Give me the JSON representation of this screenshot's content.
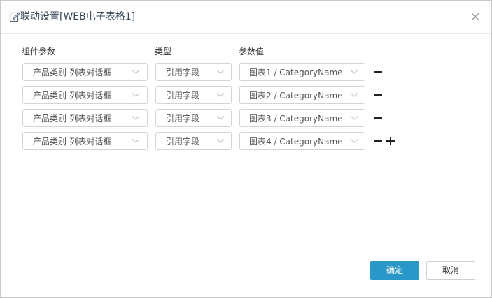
{
  "dialog": {
    "title": "联动设置[WEB电子表格1]",
    "close_icon": "close-icon",
    "edit_icon": "edit-icon"
  },
  "headers": {
    "component_param": "组件参数",
    "type": "类型",
    "param_value": "参数值"
  },
  "rows": [
    {
      "component": "产品类别-列表对话框",
      "type": "引用字段",
      "value": "图表1 / CategoryName"
    },
    {
      "component": "产品类别-列表对话框",
      "type": "引用字段",
      "value": "图表2 / CategoryName"
    },
    {
      "component": "产品类别-列表对话框",
      "type": "引用字段",
      "value": "图表3 / CategoryName"
    },
    {
      "component": "产品类别-列表对话框",
      "type": "引用字段",
      "value": "图表4 / CategoryName"
    }
  ],
  "footer": {
    "ok_label": "确定",
    "cancel_label": "取消"
  },
  "colors": {
    "primary": "#2a97c9",
    "border": "#d4d4d4",
    "title_text": "#3a4a5c"
  }
}
